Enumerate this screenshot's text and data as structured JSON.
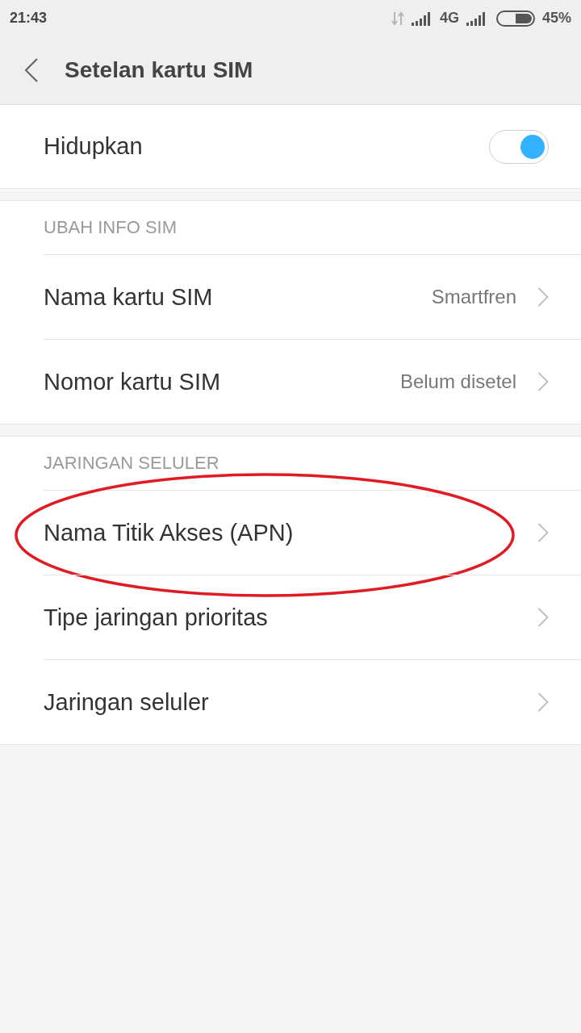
{
  "status_bar": {
    "time": "21:43",
    "network": "4G",
    "battery": "45%"
  },
  "header": {
    "title": "Setelan kartu SIM"
  },
  "master_switch": {
    "label": "Hidupkan",
    "on": true
  },
  "sections": [
    {
      "title": "UBAH INFO SIM",
      "items": [
        {
          "label": "Nama kartu SIM",
          "value": "Smartfren",
          "highlighted": false
        },
        {
          "label": "Nomor kartu SIM",
          "value": "Belum disetel",
          "highlighted": false
        }
      ]
    },
    {
      "title": "JARINGAN SELULER",
      "items": [
        {
          "label": "Nama Titik Akses (APN)",
          "highlighted": true
        },
        {
          "label": "Tipe jaringan prioritas",
          "highlighted": false
        },
        {
          "label": "Jaringan seluler",
          "highlighted": false
        }
      ]
    }
  ]
}
